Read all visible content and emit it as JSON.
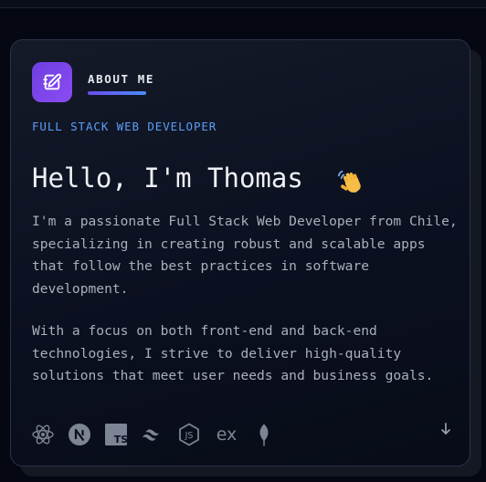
{
  "section": {
    "title": "ABOUT ME",
    "badge_icon": "notebook-pen-icon"
  },
  "profile": {
    "role": "FULL STACK WEB DEVELOPER",
    "greeting": "Hello, I'm Thomas",
    "greeting_emoji": "waving-hand",
    "paragraphs": [
      "I'm a passionate Full Stack Web Developer from Chile, specializing in creating robust and scalable apps that follow the best practices in software development.",
      "With a focus on both front-end and back-end technologies, I strive to deliver high-quality solutions that meet user needs and business goals."
    ]
  },
  "tech_stack": [
    {
      "name": "react-icon"
    },
    {
      "name": "nextjs-icon"
    },
    {
      "name": "typescript-icon",
      "label": "TS"
    },
    {
      "name": "tailwind-icon"
    },
    {
      "name": "nodejs-icon",
      "label": "JS"
    },
    {
      "name": "express-icon",
      "label": "ex"
    },
    {
      "name": "mongodb-icon"
    }
  ],
  "scroll_indicator": {
    "icon": "arrow-down-icon"
  },
  "colors": {
    "background": "#050813",
    "card": "#0b1020",
    "accent_purple": "#7c4dff",
    "accent_blue": "#5b9ef7",
    "heading": "#eef0f5",
    "body_text": "#a9afbd",
    "icon_gray": "#7d8494"
  }
}
